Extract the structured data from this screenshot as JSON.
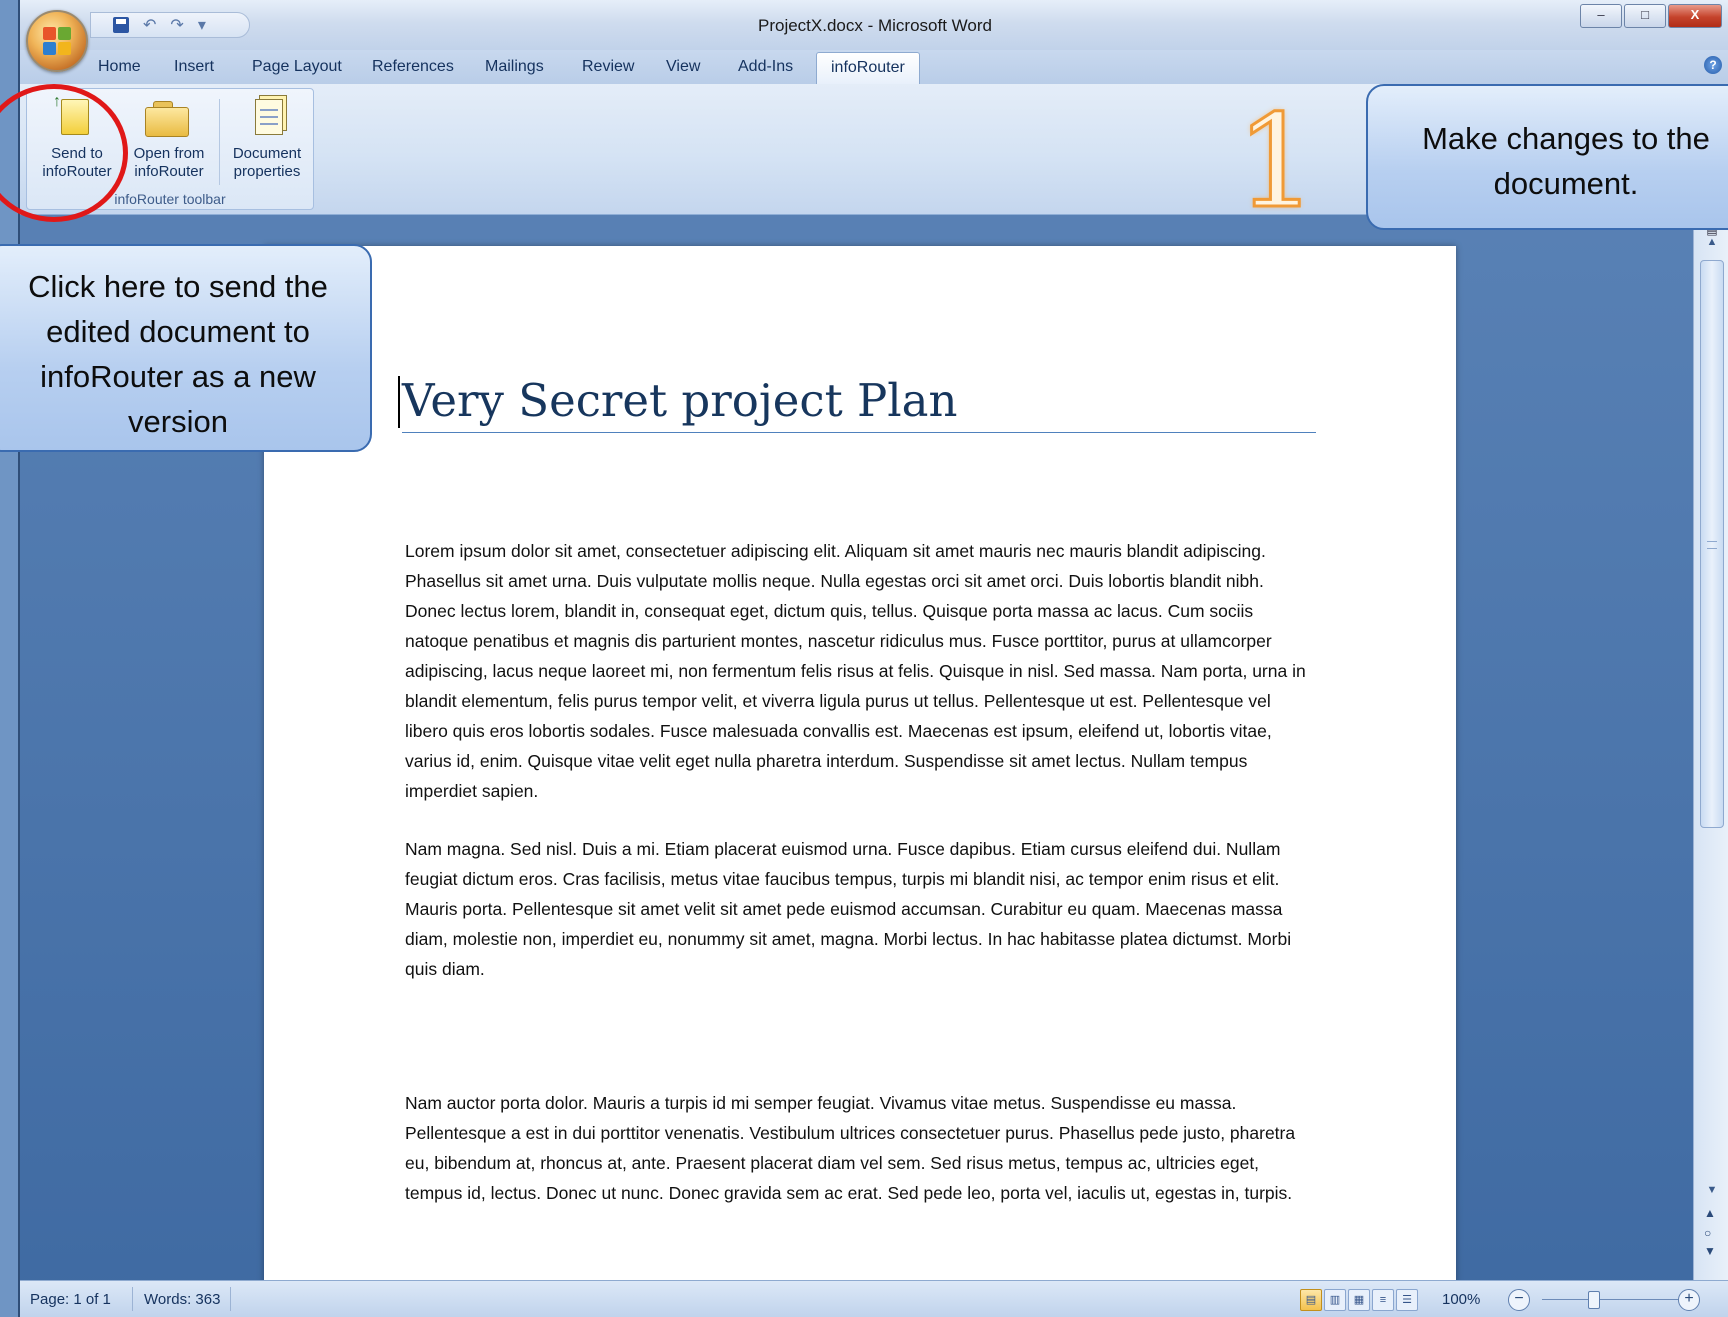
{
  "window": {
    "title": "ProjectX.docx - Microsoft Word",
    "controls": {
      "minimize": "–",
      "maximize": "□",
      "close": "X"
    }
  },
  "qat": {
    "undo_glyph": "↶",
    "redo_glyph": "↷",
    "customize_glyph": "▾"
  },
  "ribbon": {
    "tabs": [
      "Home",
      "Insert",
      "Page Layout",
      "References",
      "Mailings",
      "Review",
      "View",
      "Add-Ins",
      "infoRouter"
    ],
    "active_tab": "infoRouter",
    "group": {
      "label": "infoRouter toolbar",
      "buttons": [
        {
          "label": "Send to\ninfoRouter",
          "icon": "send-to-inforouter-icon"
        },
        {
          "label": "Open from\ninfoRouter",
          "icon": "open-folder-icon"
        },
        {
          "label": "Document\nproperties",
          "icon": "document-properties-icon"
        }
      ]
    },
    "help_glyph": "?"
  },
  "annotations": {
    "step_number": "1",
    "callout_right": "Make changes to the document.",
    "callout_left": "Click here to send the edited document to infoRouter as a new version"
  },
  "document": {
    "title": "Very Secret project Plan",
    "paragraphs": [
      "Lorem ipsum dolor sit amet, consectetuer adipiscing elit. Aliquam sit amet mauris nec mauris blandit adipiscing. Phasellus sit amet urna. Duis vulputate mollis neque. Nulla egestas orci sit amet orci. Duis lobortis blandit nibh. Donec lectus lorem, blandit in, consequat eget, dictum quis, tellus. Quisque porta massa ac lacus. Cum sociis natoque penatibus et magnis dis parturient montes, nascetur ridiculus mus. Fusce porttitor, purus at ullamcorper adipiscing, lacus neque laoreet mi, non fermentum felis risus at felis. Quisque in nisl. Sed massa. Nam porta, urna in blandit elementum, felis purus tempor velit, et viverra ligula purus ut tellus. Pellentesque ut est. Pellentesque vel libero quis eros lobortis sodales. Fusce malesuada convallis est. Maecenas est ipsum, eleifend ut, lobortis vitae, varius id, enim. Quisque vitae velit eget nulla pharetra interdum. Suspendisse sit amet lectus. Nullam tempus imperdiet sapien.",
      "Nam magna. Sed nisl. Duis a mi. Etiam placerat euismod urna. Fusce dapibus. Etiam cursus eleifend dui. Nullam feugiat dictum eros. Cras facilisis, metus vitae faucibus tempus, turpis mi blandit nisi, ac tempor enim risus et elit. Mauris porta. Pellentesque sit amet velit sit amet pede euismod accumsan. Curabitur eu quam. Maecenas massa diam, molestie non, imperdiet eu, nonummy sit amet, magna. Morbi lectus. In hac habitasse platea dictumst. Morbi quis diam.",
      "Nam auctor porta dolor. Mauris a turpis id mi semper feugiat. Vivamus vitae metus. Suspendisse eu massa. Pellentesque a est in dui porttitor venenatis. Vestibulum ultrices consectetuer purus. Phasellus pede justo, pharetra eu, bibendum at, rhoncus at, ante. Praesent placerat diam vel sem. Sed risus metus, tempus ac, ultricies eget, tempus id, lectus. Donec ut nunc. Donec gravida sem ac erat. Sed pede leo, porta vel, iaculis ut, egestas in, turpis."
    ]
  },
  "statusbar": {
    "page": "Page: 1 of 1",
    "words": "Words: 363",
    "zoom": "100%",
    "zoom_minus": "−",
    "zoom_plus": "+"
  },
  "colors": {
    "accent_circle": "#e01818",
    "step_number_stroke": "#f09a36",
    "title_color": "#17365d"
  }
}
